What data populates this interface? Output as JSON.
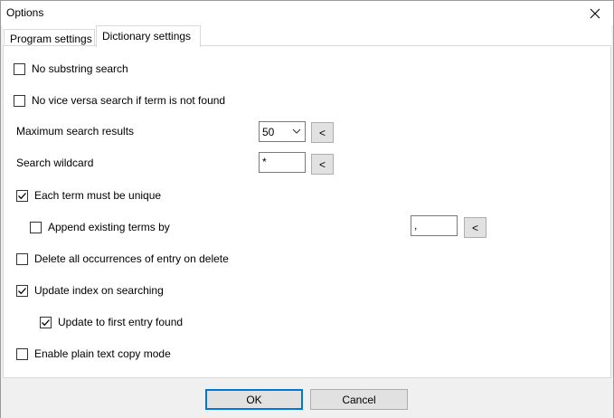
{
  "window": {
    "title": "Options"
  },
  "tabs": [
    {
      "label": "Program settings"
    },
    {
      "label": "Dictionary settings"
    }
  ],
  "options": {
    "no_substring_search": {
      "label": "No substring search",
      "checked": false
    },
    "no_vice_versa": {
      "label": "No vice versa search if term is not found",
      "checked": false
    },
    "max_results": {
      "label": "Maximum search results",
      "value": "50",
      "button": "<"
    },
    "wildcard": {
      "label": "Search wildcard",
      "value": "*",
      "button": "<"
    },
    "unique_term": {
      "label": "Each term must be unique",
      "checked": true
    },
    "append_existing": {
      "label": "Append existing terms by",
      "checked": false,
      "value": ",",
      "button": "<"
    },
    "delete_all": {
      "label": "Delete all occurrences of entry on delete",
      "checked": false
    },
    "update_index": {
      "label": "Update index on searching",
      "checked": true
    },
    "update_first": {
      "label": "Update to first entry found",
      "checked": true
    },
    "plain_text": {
      "label": "Enable plain text copy mode",
      "checked": false
    }
  },
  "footer": {
    "ok_label": "OK",
    "cancel_label": "Cancel"
  },
  "colors": {
    "accent": "#0078d7",
    "panel_bg": "#ffffff",
    "window_bg": "#f0f0f0"
  },
  "icons": {
    "close": "close-icon",
    "dropdown": "chevron-down-icon",
    "check": "checkmark-icon"
  }
}
